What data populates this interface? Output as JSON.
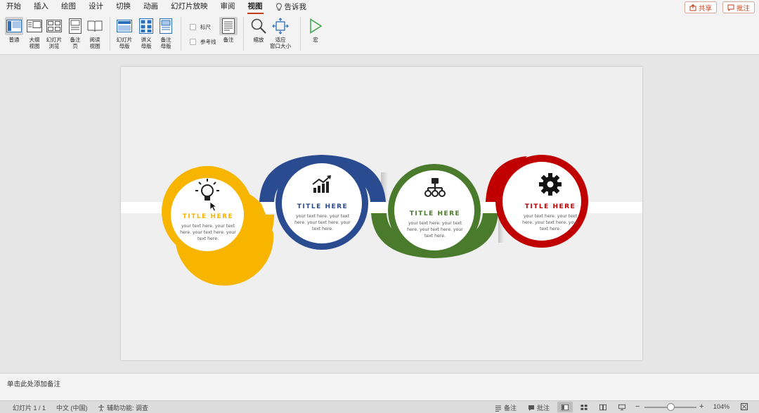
{
  "tabs": [
    {
      "label": "开始"
    },
    {
      "label": "插入"
    },
    {
      "label": "绘图"
    },
    {
      "label": "设计"
    },
    {
      "label": "切换"
    },
    {
      "label": "动画"
    },
    {
      "label": "幻灯片放映"
    },
    {
      "label": "审阅"
    },
    {
      "label": "视图",
      "active": true
    }
  ],
  "tell_me": "告诉我",
  "share_label": "共享",
  "comment_label": "批注",
  "ribbon": {
    "normal": "普通",
    "outline": "大纲\n视图",
    "sorter": "幻灯片\n浏览",
    "notes_page": "备注\n页",
    "reading": "阅读\n视图",
    "slide_master": "幻灯片\n母版",
    "handout_master": "讲义\n母版",
    "notes_master": "备注\n母版",
    "ruler": "标尺",
    "guides": "参考线",
    "notes": "备注",
    "zoom": "缩放",
    "fit_window": "适应\n窗口大小",
    "macro": "宏"
  },
  "slide": {
    "cards": [
      {
        "title": "TITLE HERE",
        "line1": "your text here. your text",
        "line2": "here. your text here. your",
        "line3": "text here.",
        "color": "#f7b500",
        "icon": "lightbulb-icon"
      },
      {
        "title": "TITLE HERE",
        "line1": "your text here. your text",
        "line2": "here. your text here. your",
        "line3": "text here.",
        "color": "#2b4b91",
        "icon": "growth-chart-icon"
      },
      {
        "title": "TITLE HERE",
        "line1": "your text here. your text",
        "line2": "here. your text here. your",
        "line3": "text here.",
        "color": "#4a7a2c",
        "icon": "hierarchy-icon"
      },
      {
        "title": "TITLE HERE",
        "line1": "your text here. your text",
        "line2": "here. your text here. your",
        "line3": "text here.",
        "color": "#c00000",
        "icon": "gear-icon"
      }
    ]
  },
  "notes_placeholder": "单击此处添加备注",
  "status": {
    "slide_count": "幻灯片 1 / 1",
    "language": "中文 (中国)",
    "accessibility": "辅助功能: 调查",
    "notes": "备注",
    "comments": "批注",
    "zoom": "104%"
  }
}
